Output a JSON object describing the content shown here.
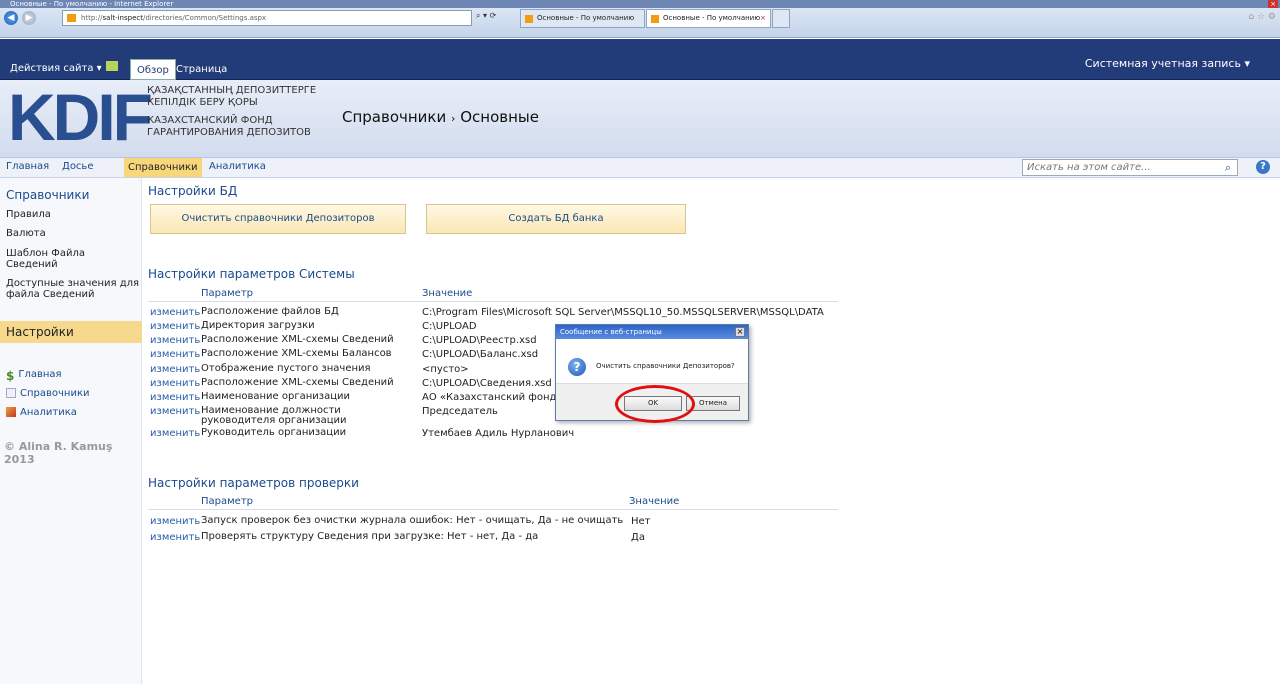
{
  "browser": {
    "title": "Основные - По умолчанию - Internet Explorer",
    "url_prefix": "http://",
    "url_host": "salt-inspect",
    "url_path": "/directories/Common/Settings.aspx",
    "tabs": [
      "Основные - По умолчанию",
      "Основные - По умолчанию"
    ]
  },
  "ribbon": {
    "site_actions": "Действия сайта",
    "tabs": [
      "Обзор",
      "Страница"
    ],
    "account": "Системная учетная запись"
  },
  "header": {
    "logo": "KDIF",
    "org_kz_1": "ҚАЗАҚСТАННЫҢ ДЕПОЗИТТЕРГЕ",
    "org_kz_2": "КЕПІЛДІК БЕРУ ҚОРЫ",
    "org_ru_1": "КАЗАХСТАНСКИЙ ФОНД",
    "org_ru_2": "ГАРАНТИРОВАНИЯ ДЕПОЗИТОВ",
    "breadcrumb_1": "Справочники",
    "breadcrumb_sep": "›",
    "breadcrumb_2": "Основные"
  },
  "topnav": {
    "items": [
      "Главная",
      "Досье",
      "Справочники",
      "Аналитика"
    ],
    "search_placeholder": "Искать на этом сайте..."
  },
  "sidebar": {
    "section": "Справочники",
    "items": [
      "Правила",
      "Валюта",
      "Шаблон Файла Сведений",
      "Доступные значения для файла Сведений"
    ],
    "active": "Настройки",
    "quick": [
      "Главная",
      "Справочники",
      "Аналитика"
    ],
    "copyright": "© Alina R. Kamuş 2013"
  },
  "main": {
    "db_title": "Настройки БД",
    "btn_clear": "Очистить справочники Депозиторов",
    "btn_create": "Создать БД банка",
    "sys_title": "Настройки параметров Системы",
    "col_param": "Параметр",
    "col_value": "Значение",
    "edit": "изменить",
    "sys_rows": [
      {
        "p": "Расположение файлов БД",
        "v": "C:\\Program Files\\Microsoft SQL Server\\MSSQL10_50.MSSQLSERVER\\MSSQL\\DATA"
      },
      {
        "p": "Директория загрузки",
        "v": "C:\\UPLOAD"
      },
      {
        "p": "Расположение XML-схемы Сведений",
        "v": "C:\\UPLOAD\\Реестр.xsd"
      },
      {
        "p": "Расположение XML-схемы Балансов",
        "v": "C:\\UPLOAD\\Баланс.xsd"
      },
      {
        "p": "Отображение пустого значения",
        "v": "<пусто>"
      },
      {
        "p": "Расположение XML-схемы Сведений",
        "v": "C:\\UPLOAD\\Сведения.xsd"
      },
      {
        "p": "Наименование организации",
        "v": "АО «Казахстанский фонд"
      },
      {
        "p": "Наименование должности руководителя организации",
        "v": "Председатель"
      },
      {
        "p": "Руководитель организации",
        "v": "Утембаев Адиль Нурланович"
      }
    ],
    "check_title": "Настройки параметров проверки",
    "check_rows": [
      {
        "p": "Запуск проверок без очистки журнала ошибок: Нет - очищать, Да - не очищать",
        "v": "Нет"
      },
      {
        "p": "Проверять структуру Сведения при загрузке: Нет - нет, Да - да",
        "v": "Да"
      }
    ]
  },
  "dialog": {
    "title": "Сообщение с веб-страницы",
    "message": "Очистить справочники Депозиторов?",
    "ok": "OK",
    "cancel": "Отмена"
  }
}
